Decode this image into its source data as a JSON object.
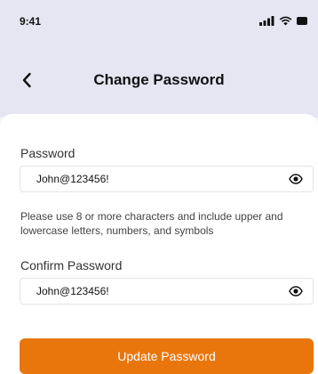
{
  "status_bar": {
    "time": "9:41",
    "icons": [
      "signal-icon",
      "wifi-icon",
      "battery-icon"
    ]
  },
  "nav": {
    "title": "Change Password",
    "back_icon": "chevron-left-icon"
  },
  "form": {
    "password": {
      "label": "Password",
      "value": "John@123456!",
      "toggle_icon": "eye-icon"
    },
    "hint": "Please use 8 or more characters and include upper and lowercase letters, numbers, and symbols",
    "confirm_password": {
      "label": "Confirm Password",
      "value": "John@123456!",
      "toggle_icon": "eye-icon"
    },
    "submit_label": "Update Password"
  },
  "colors": {
    "header_bg": "#e6e6f3",
    "accent": "#e8760c"
  }
}
